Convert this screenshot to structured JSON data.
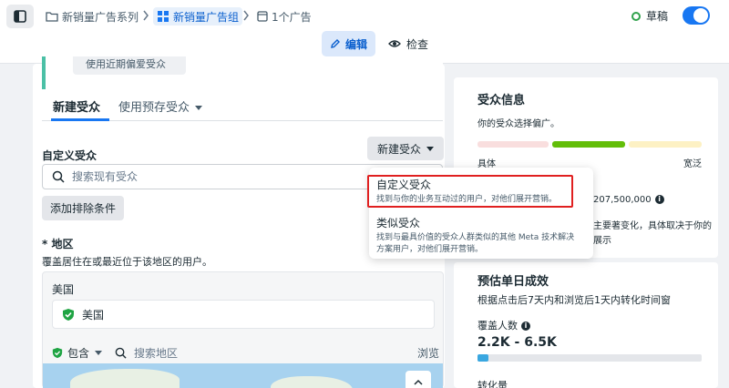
{
  "breadcrumb": {
    "campaign": "新销量广告系列",
    "adset": "新销量广告组",
    "ad": "1个广告"
  },
  "status": {
    "label": "草稿",
    "toggle_on": true
  },
  "mode": {
    "edit_label": "编辑",
    "review_label": "检查"
  },
  "audience": {
    "prev_button_label": "使用近期偏爱受众",
    "tabs": [
      {
        "label": "新建受众",
        "active": true
      },
      {
        "label": "使用预存受众",
        "active": false
      }
    ],
    "custom_title": "自定义受众",
    "new_audience_button": "新建受众",
    "search_placeholder": "搜索现有受众",
    "add_exclusion_label": "添加排除条件"
  },
  "location": {
    "required_mark": "*",
    "title": "地区",
    "description": "覆盖居住在或最近位于该地区的用户。",
    "country": "美国",
    "chip": "美国",
    "include_label": "包含",
    "search_placeholder": "搜索地区",
    "browse_label": "浏览"
  },
  "dropdown": {
    "items": [
      {
        "title": "自定义受众",
        "description": "找到与你的业务互动过的用户，对他们展开营销。"
      },
      {
        "title": "类似受众",
        "description_line1": "找到与最具价值的受众人群类似的其他 Meta 技术解决",
        "description_line2": "方案用户，对他们展开营销。"
      }
    ]
  },
  "audience_info": {
    "title": "受众信息",
    "subtitle": "你的受众选择偏广。",
    "meter_left": "具体",
    "meter_right": "宽泛",
    "size_value": "207,500,000",
    "note_line1": "主要著变化，具体取决于你的",
    "note_line2": "展示"
  },
  "daily_results": {
    "title": "预估单日成效",
    "subtitle": "根据点击后7天内和浏览后1天内转化时间窗",
    "reach_label": "覆盖人数",
    "reach_value": "2.2K - 6.5K",
    "reach_level": 0.05,
    "conversions_label": "转化量"
  },
  "colors": {
    "primary": "#1877f2",
    "highlight_border": "#e02020",
    "meter_narrow": "#f9dede",
    "meter_good": "#63be09",
    "meter_broad": "#fdf1c4",
    "check_green": "#1fa443"
  }
}
